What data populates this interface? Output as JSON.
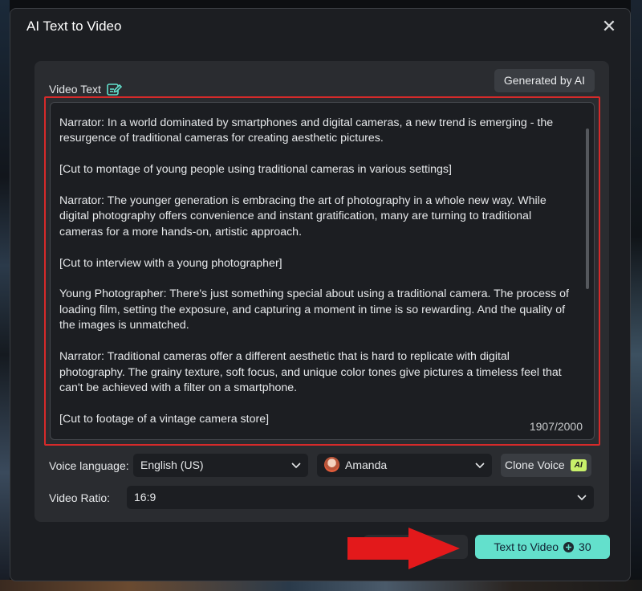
{
  "dialog": {
    "title": "AI Text to Video"
  },
  "video_text": {
    "label": "Video Text",
    "generated_button": "Generated by AI",
    "content": "Narrator: In a world dominated by smartphones and digital cameras, a new trend is emerging - the resurgence of traditional cameras for creating aesthetic pictures.\n\n[Cut to montage of young people using traditional cameras in various settings]\n\nNarrator: The younger generation is embracing the art of photography in a whole new way. While digital photography offers convenience and instant gratification, many are turning to traditional cameras for a more hands-on, artistic approach.\n\n[Cut to interview with a young photographer]\n\nYoung Photographer: There's just something special about using a traditional camera. The process of loading film, setting the exposure, and capturing a moment in time is so rewarding. And the quality of the images is unmatched.\n\nNarrator: Traditional cameras offer a different aesthetic that is hard to replicate with digital photography. The grainy texture, soft focus, and unique color tones give pictures a timeless feel that can't be achieved with a filter on a smartphone.\n\n[Cut to footage of a vintage camera store]",
    "counter": "1907/2000"
  },
  "voice": {
    "language_label": "Voice language:",
    "language_value": "English (US)",
    "voice_name": "Amanda",
    "clone_button": "Clone Voice",
    "clone_badge": "AI"
  },
  "ratio": {
    "label": "Video Ratio:",
    "value": "16:9"
  },
  "action": {
    "text_to_video_label": "Text to Video",
    "credits": "30"
  },
  "colors": {
    "accent": "#63e0cc",
    "highlight_border": "#d62a2a",
    "arrow": "#e3191b",
    "ai_badge": "#c8f06a"
  }
}
